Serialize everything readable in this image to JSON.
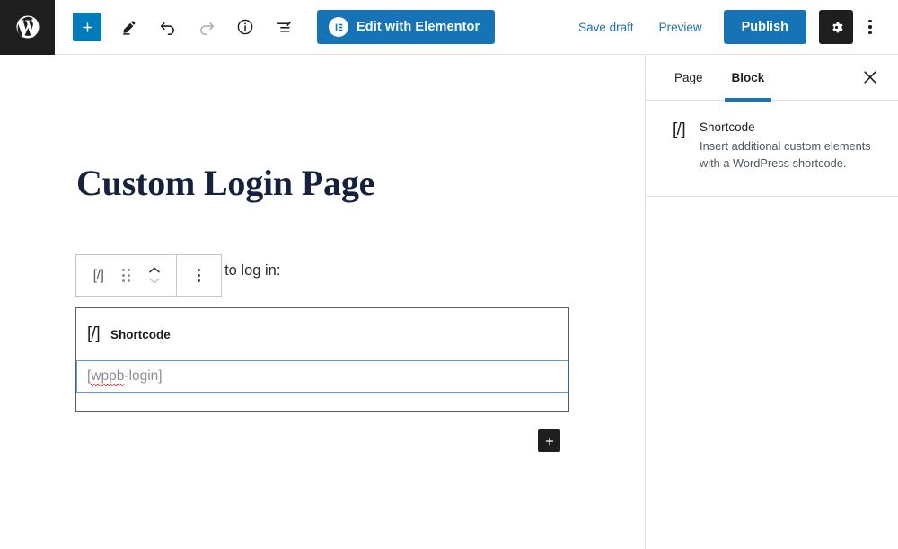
{
  "header": {
    "logo_label": "WordPress",
    "add_block_label": "+",
    "tools": [
      {
        "name": "add-block-button",
        "label": "Add block"
      },
      {
        "name": "edit-tool-button",
        "label": "Tools"
      },
      {
        "name": "undo-button",
        "label": "Undo"
      },
      {
        "name": "redo-button",
        "label": "Redo"
      },
      {
        "name": "details-button",
        "label": "Details"
      },
      {
        "name": "list-view-button",
        "label": "List view"
      }
    ],
    "elementor_button": "Edit with Elementor",
    "save_draft": "Save draft",
    "preview": "Preview",
    "publish": "Publish",
    "settings_label": "Settings",
    "options_label": "Options"
  },
  "canvas": {
    "page_title": "Custom Login Page",
    "paragraph_text": "t? Use the form below to log in:",
    "block_toolbar": {
      "shortcode_glyph": "[/]",
      "drag_label": "Drag",
      "move_up_label": "Move up",
      "move_down_label": "Move down",
      "options_label": "Options"
    },
    "shortcode_block": {
      "icon": "[/]",
      "label": "Shortcode",
      "value": "[wppb-login]",
      "value_spell_part": "wppb",
      "value_rest": "-login]",
      "value_open": "["
    },
    "add_block_label": "+"
  },
  "sidebar": {
    "tabs": [
      {
        "label": "Page",
        "active": false
      },
      {
        "label": "Block",
        "active": true
      }
    ],
    "close_label": "Close settings",
    "block_info": {
      "icon": "[/]",
      "title": "Shortcode",
      "description": "Insert additional custom elements with a WordPress shortcode."
    }
  },
  "colors": {
    "accent_blue": "#1573b6",
    "add_button_blue": "#007cba",
    "dark": "#1e1e1e",
    "title_navy": "#16213e",
    "focus_blue": "#5b9dd9",
    "spell_red": "#e03030"
  }
}
